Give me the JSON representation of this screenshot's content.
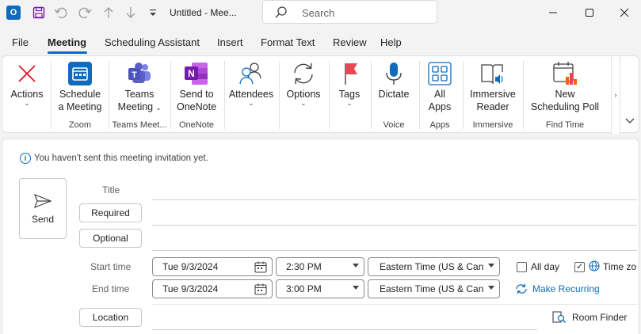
{
  "window": {
    "title": "Untitled  -  Mee...",
    "search_placeholder": "Search"
  },
  "menu": {
    "tabs": [
      "File",
      "Meeting",
      "Scheduling Assistant",
      "Insert",
      "Format Text",
      "Review",
      "Help"
    ],
    "active_tab": "Meeting"
  },
  "ribbon": {
    "actions": "Actions",
    "schedule_line1": "Schedule",
    "schedule_line2": "a Meeting",
    "group_zoom": "Zoom",
    "teams_line1": "Teams",
    "teams_line2": "Meeting",
    "group_teams": "Teams Meet...",
    "onenote_line1": "Send to",
    "onenote_line2": "OneNote",
    "group_onenote": "OneNote",
    "attendees": "Attendees",
    "options": "Options",
    "tags": "Tags",
    "dictate": "Dictate",
    "group_voice": "Voice",
    "apps_line1": "All",
    "apps_line2": "Apps",
    "group_apps": "Apps",
    "immersive_line1": "Immersive",
    "immersive_line2": "Reader",
    "group_immersive": "Immersive",
    "poll_line1": "New",
    "poll_line2": "Scheduling Poll",
    "group_findtime": "Find Time"
  },
  "form": {
    "info_message": "You haven't sent this meeting invitation yet.",
    "send_label": "Send",
    "title_label": "Title",
    "required_label": "Required",
    "optional_label": "Optional",
    "start_time_label": "Start time",
    "end_time_label": "End time",
    "start_date": "Tue 9/3/2024",
    "start_time": "2:30 PM",
    "end_date": "Tue 9/3/2024",
    "end_time": "3:00 PM",
    "timezone_start": "Eastern Time (US & Cana",
    "timezone_end": "Eastern Time (US & Cana",
    "all_day_label": "All day",
    "all_day_checked": false,
    "time_zones_label": "Time zo",
    "time_zones_checked": true,
    "make_recurring": "Make Recurring",
    "location_label": "Location",
    "room_finder": "Room Finder"
  },
  "colors": {
    "accent": "#0f6cbd",
    "background": "#f3f3f3",
    "outlook_blue": "#0f6cbd",
    "onenote_purple": "#7719aa",
    "teams_purple": "#5b5fc7",
    "tags_red": "#e74856",
    "actions_red": "#e81123"
  }
}
